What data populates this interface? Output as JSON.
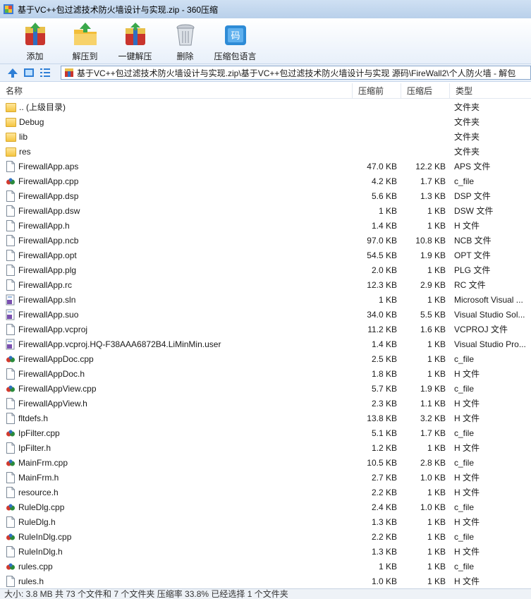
{
  "window": {
    "title": "基于VC++包过滤技术防火墙设计与实现.zip - 360压缩"
  },
  "toolbar": {
    "buttons": [
      {
        "label": "添加",
        "icon": "add-archive-icon"
      },
      {
        "label": "解压到",
        "icon": "extract-to-icon"
      },
      {
        "label": "一键解压",
        "icon": "one-click-extract-icon"
      },
      {
        "label": "删除",
        "icon": "trash-icon"
      },
      {
        "label": "压缩包语言",
        "icon": "language-icon"
      }
    ]
  },
  "address": {
    "path": "基于VC++包过滤技术防火墙设计与实现.zip\\基于VC++包过滤技术防火墙设计与实现 源码\\FireWall2\\个人防火墙 - 解包"
  },
  "columns": {
    "name": "名称",
    "size": "压缩前",
    "packed": "压缩后",
    "type": "类型"
  },
  "files": [
    {
      "name": ".. (上级目录)",
      "size": "",
      "packed": "",
      "type": "文件夹",
      "icon": "folder"
    },
    {
      "name": "Debug",
      "size": "",
      "packed": "",
      "type": "文件夹",
      "icon": "folder"
    },
    {
      "name": "lib",
      "size": "",
      "packed": "",
      "type": "文件夹",
      "icon": "folder"
    },
    {
      "name": "res",
      "size": "",
      "packed": "",
      "type": "文件夹",
      "icon": "folder"
    },
    {
      "name": "FirewallApp.aps",
      "size": "47.0 KB",
      "packed": "12.2 KB",
      "type": "APS 文件",
      "icon": "file"
    },
    {
      "name": "FirewallApp.cpp",
      "size": "4.2 KB",
      "packed": "1.7 KB",
      "type": "c_file",
      "icon": "cpp"
    },
    {
      "name": "FirewallApp.dsp",
      "size": "5.6 KB",
      "packed": "1.3 KB",
      "type": "DSP 文件",
      "icon": "file"
    },
    {
      "name": "FirewallApp.dsw",
      "size": "1 KB",
      "packed": "1 KB",
      "type": "DSW 文件",
      "icon": "file"
    },
    {
      "name": "FirewallApp.h",
      "size": "1.4 KB",
      "packed": "1 KB",
      "type": "H 文件",
      "icon": "file"
    },
    {
      "name": "FirewallApp.ncb",
      "size": "97.0 KB",
      "packed": "10.8 KB",
      "type": "NCB 文件",
      "icon": "file"
    },
    {
      "name": "FirewallApp.opt",
      "size": "54.5 KB",
      "packed": "1.9 KB",
      "type": "OPT 文件",
      "icon": "file"
    },
    {
      "name": "FirewallApp.plg",
      "size": "2.0 KB",
      "packed": "1 KB",
      "type": "PLG 文件",
      "icon": "file"
    },
    {
      "name": "FirewallApp.rc",
      "size": "12.3 KB",
      "packed": "2.9 KB",
      "type": "RC 文件",
      "icon": "file"
    },
    {
      "name": "FirewallApp.sln",
      "size": "1 KB",
      "packed": "1 KB",
      "type": "Microsoft Visual ...",
      "icon": "vs"
    },
    {
      "name": "FirewallApp.suo",
      "size": "34.0 KB",
      "packed": "5.5 KB",
      "type": "Visual Studio Sol...",
      "icon": "vs"
    },
    {
      "name": "FirewallApp.vcproj",
      "size": "11.2 KB",
      "packed": "1.6 KB",
      "type": "VCPROJ 文件",
      "icon": "file"
    },
    {
      "name": "FirewallApp.vcproj.HQ-F38AAA6872B4.LiMinMin.user",
      "size": "1.4 KB",
      "packed": "1 KB",
      "type": "Visual Studio Pro...",
      "icon": "vs"
    },
    {
      "name": "FirewallAppDoc.cpp",
      "size": "2.5 KB",
      "packed": "1 KB",
      "type": "c_file",
      "icon": "cpp"
    },
    {
      "name": "FirewallAppDoc.h",
      "size": "1.8 KB",
      "packed": "1 KB",
      "type": "H 文件",
      "icon": "file"
    },
    {
      "name": "FirewallAppView.cpp",
      "size": "5.7 KB",
      "packed": "1.9 KB",
      "type": "c_file",
      "icon": "cpp"
    },
    {
      "name": "FirewallAppView.h",
      "size": "2.3 KB",
      "packed": "1.1 KB",
      "type": "H 文件",
      "icon": "file"
    },
    {
      "name": "fltdefs.h",
      "size": "13.8 KB",
      "packed": "3.2 KB",
      "type": "H 文件",
      "icon": "file"
    },
    {
      "name": "IpFilter.cpp",
      "size": "5.1 KB",
      "packed": "1.7 KB",
      "type": "c_file",
      "icon": "cpp"
    },
    {
      "name": "IpFilter.h",
      "size": "1.2 KB",
      "packed": "1 KB",
      "type": "H 文件",
      "icon": "file"
    },
    {
      "name": "MainFrm.cpp",
      "size": "10.5 KB",
      "packed": "2.8 KB",
      "type": "c_file",
      "icon": "cpp"
    },
    {
      "name": "MainFrm.h",
      "size": "2.7 KB",
      "packed": "1.0 KB",
      "type": "H 文件",
      "icon": "file"
    },
    {
      "name": "resource.h",
      "size": "2.2 KB",
      "packed": "1 KB",
      "type": "H 文件",
      "icon": "file"
    },
    {
      "name": "RuleDlg.cpp",
      "size": "2.4 KB",
      "packed": "1.0 KB",
      "type": "c_file",
      "icon": "cpp"
    },
    {
      "name": "RuleDlg.h",
      "size": "1.3 KB",
      "packed": "1 KB",
      "type": "H 文件",
      "icon": "file"
    },
    {
      "name": "RuleInDlg.cpp",
      "size": "2.2 KB",
      "packed": "1 KB",
      "type": "c_file",
      "icon": "cpp"
    },
    {
      "name": "RuleInDlg.h",
      "size": "1.3 KB",
      "packed": "1 KB",
      "type": "H 文件",
      "icon": "file"
    },
    {
      "name": "rules.cpp",
      "size": "1 KB",
      "packed": "1 KB",
      "type": "c_file",
      "icon": "cpp"
    },
    {
      "name": "rules.h",
      "size": "1.0 KB",
      "packed": "1 KB",
      "type": "H 文件",
      "icon": "file"
    }
  ],
  "status": {
    "text": "大小: 3.8 MB 共 73 个文件和 7 个文件夹 压缩率 33.8% 已经选择 1 个文件夹"
  }
}
